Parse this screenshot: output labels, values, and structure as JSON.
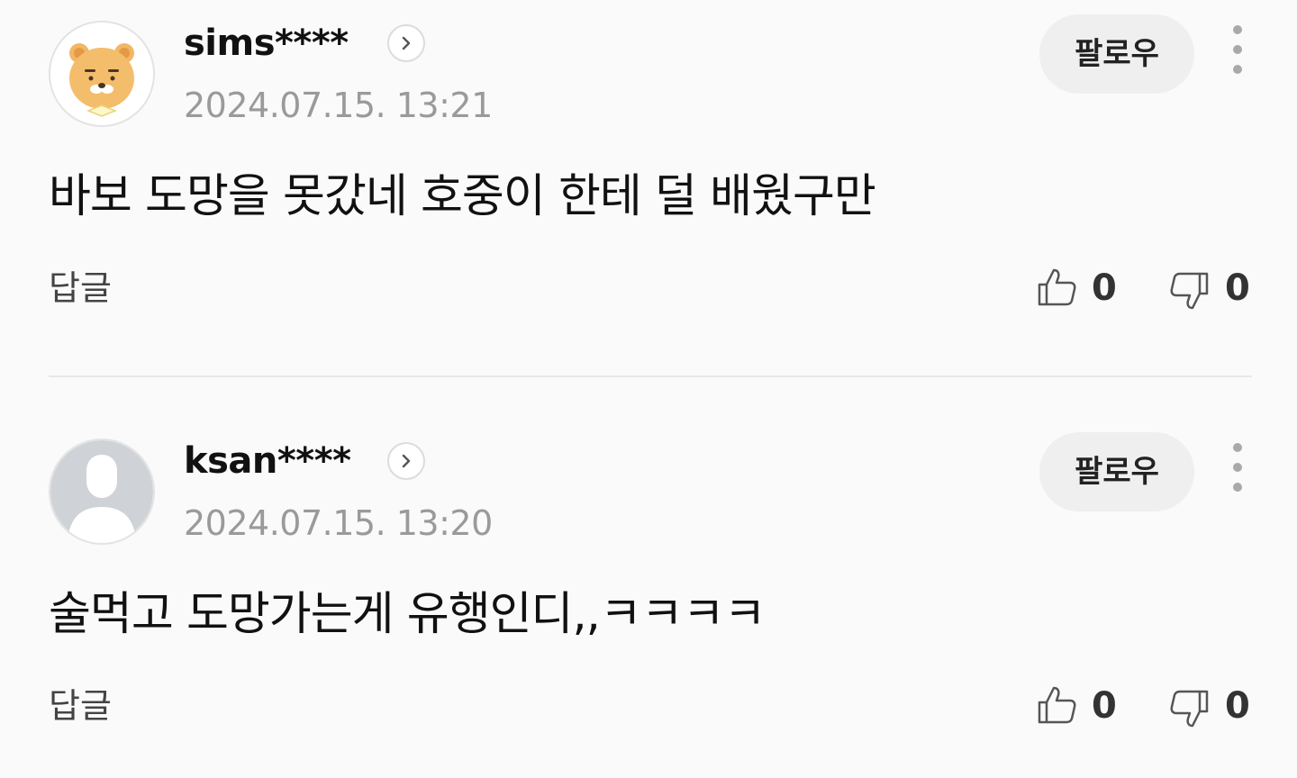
{
  "comments": [
    {
      "username": "sims****",
      "timestamp": "2024.07.15. 13:21",
      "text": "바보 도망을 못갔네 호중이 한테 덜 배웠구만",
      "follow_label": "팔로우",
      "reply_label": "답글",
      "likes": "0",
      "dislikes": "0",
      "avatar": "ryan-bear-avatar"
    },
    {
      "username": "ksan****",
      "timestamp": "2024.07.15. 13:20",
      "text": "술먹고 도망가는게 유행인디,,ㅋㅋㅋㅋ",
      "follow_label": "팔로우",
      "reply_label": "답글",
      "likes": "0",
      "dislikes": "0",
      "avatar": "default-person-avatar"
    }
  ],
  "icons": {
    "profile_link": "chevron-right-icon",
    "more": "more-vertical-icon",
    "like": "thumbs-up-icon",
    "dislike": "thumbs-down-icon"
  },
  "colors": {
    "background": "#fafafa",
    "muted_text": "#9a9a9a",
    "follow_button_bg": "#efefef"
  }
}
